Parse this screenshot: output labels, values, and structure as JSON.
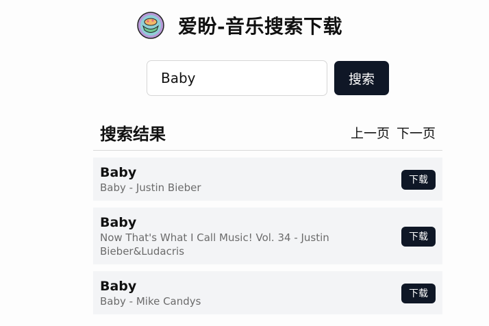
{
  "header": {
    "logo_icon": "music-bowl-logo-icon",
    "title": "爱盼-音乐搜索下载"
  },
  "search": {
    "value": "Baby",
    "button_label": "搜索"
  },
  "results": {
    "title": "搜索结果",
    "prev_label": "上一页",
    "next_label": "下一页",
    "items": [
      {
        "name": "Baby",
        "meta": "Baby - Justin Bieber",
        "download_label": "下载"
      },
      {
        "name": "Baby",
        "meta": "Now That's What I Call Music! Vol. 34 - Justin Bieber&Ludacris",
        "download_label": "下载"
      },
      {
        "name": "Baby",
        "meta": "Baby - Mike Candys",
        "download_label": "下载"
      }
    ]
  },
  "colors": {
    "primary_button": "#0f1726",
    "item_background": "#f3f4f6",
    "meta_text": "#6b6b6b"
  }
}
